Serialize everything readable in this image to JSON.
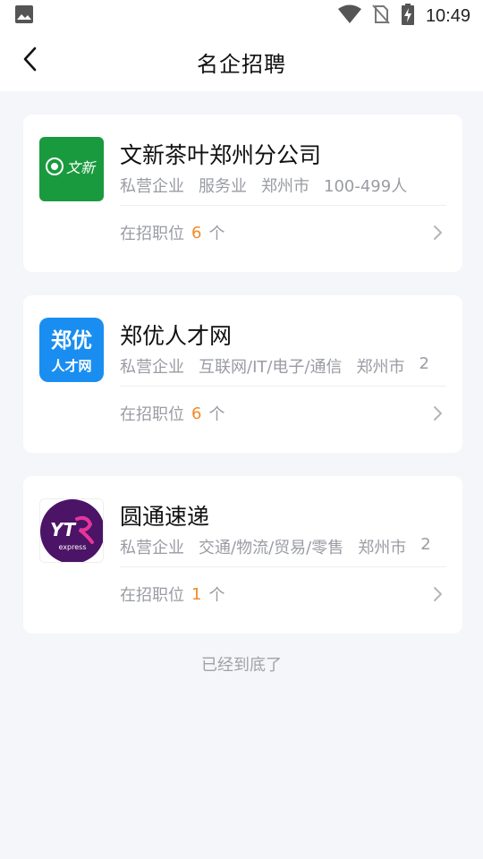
{
  "status_bar": {
    "time": "10:49",
    "icons": [
      "image-icon",
      "wifi-icon",
      "no-sim-icon",
      "battery-charging-icon"
    ]
  },
  "header": {
    "title": "名企招聘",
    "back_icon": "chevron-left-icon"
  },
  "companies": [
    {
      "name": "文新茶叶郑州分公司",
      "logo_text": "文新",
      "logo_bg": "#1a9a3e",
      "tags": [
        "私营企业",
        "服务业",
        "郑州市",
        "100-499人"
      ],
      "jobs_label": "在招职位",
      "jobs_count": "6",
      "jobs_unit": "个"
    },
    {
      "name": "郑优人才网",
      "logo_text_1": "郑优",
      "logo_text_2": "人才网",
      "logo_bg": "#1a8ef0",
      "tags": [
        "私营企业",
        "互联网/IT/电子/通信",
        "郑州市",
        "2"
      ],
      "jobs_label": "在招职位",
      "jobs_count": "6",
      "jobs_unit": "个"
    },
    {
      "name": "圆通速递",
      "logo_text": "YT",
      "logo_sub": "express",
      "logo_bg": "#4b1466",
      "tags": [
        "私营企业",
        "交通/物流/贸易/零售",
        "郑州市",
        "2"
      ],
      "jobs_label": "在招职位",
      "jobs_count": "1",
      "jobs_unit": "个"
    }
  ],
  "footer": {
    "end_text": "已经到底了"
  },
  "colors": {
    "accent": "#f08a26",
    "background": "#f5f6fa",
    "muted_text": "#9a9ca3"
  }
}
